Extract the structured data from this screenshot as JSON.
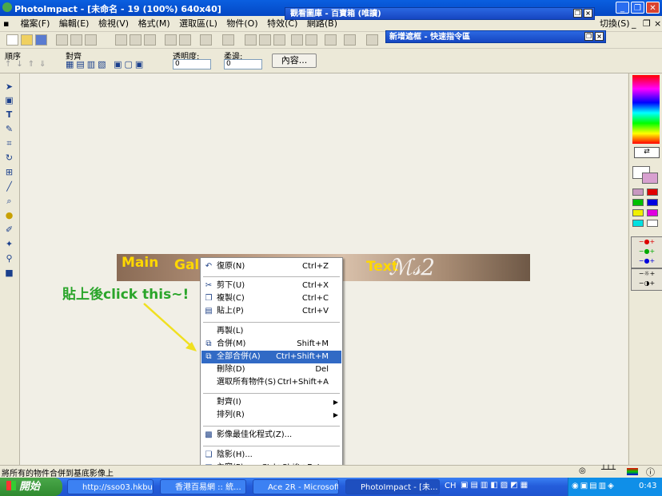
{
  "window": {
    "title": "PhotoImpact - [未命名 - 19 (100%) 640x40]"
  },
  "menu": [
    "檔案(F)",
    "編輯(E)",
    "檢視(V)",
    "格式(M)",
    "選取區(L)",
    "物件(O)",
    "特效(C)",
    "網路(B)"
  ],
  "menu_right": "切換(S)",
  "panels": {
    "panel1": "觀看圖庫 - 百寶箱 (唯讀)",
    "panel2": "新增遮框 - 快速指令區"
  },
  "attr": {
    "order_label": "順序",
    "align_label": "對齊",
    "transparency_label": "透明度:",
    "transparency_value": "0",
    "soft_edge_label": "柔邊:",
    "soft_edge_value": "0",
    "properties_button": "內容..."
  },
  "canvas": {
    "banner_main": "Main",
    "banner_gal": "Gal",
    "banner_text": "Text"
  },
  "annotation": {
    "text": "貼上後click this~!"
  },
  "context_menu": [
    {
      "label": "復原(N)",
      "shortcut": "Ctrl+Z",
      "icon": "undo-icon"
    },
    {
      "label": "剪下(U)",
      "shortcut": "Ctrl+X",
      "icon": "cut-icon"
    },
    {
      "label": "複製(C)",
      "shortcut": "Ctrl+C",
      "icon": "copy-icon"
    },
    {
      "label": "貼上(P)",
      "shortcut": "Ctrl+V",
      "icon": "paste-icon"
    },
    {
      "label": "再製(L)",
      "shortcut": "",
      "icon": ""
    },
    {
      "label": "合併(M)",
      "shortcut": "Shift+M",
      "icon": "merge-icon"
    },
    {
      "label": "全部合併(A)",
      "shortcut": "Ctrl+Shift+M",
      "icon": "merge-all-icon"
    },
    {
      "label": "刪除(D)",
      "shortcut": "Del",
      "icon": ""
    },
    {
      "label": "選取所有物件(S)",
      "shortcut": "Ctrl+Shift+A",
      "icon": ""
    },
    {
      "label": "對齊(I)",
      "shortcut": "",
      "icon": ""
    },
    {
      "label": "排列(R)",
      "shortcut": "",
      "icon": ""
    },
    {
      "label": "影像最佳化程式(Z)...",
      "shortcut": "",
      "icon": "optimizer-icon"
    },
    {
      "label": "陰影(H)...",
      "shortcut": "",
      "icon": "shadow-icon"
    },
    {
      "label": "內容(P)...",
      "shortcut": "Ctrl+Shift+Enter",
      "icon": "properties-icon"
    }
  ],
  "highlighted_item": "全部合併(A)",
  "status": {
    "text": "將所有的物件合併到基底影像上"
  },
  "taskbar": {
    "start_label": "開始",
    "tasks": [
      "http://sso03.hkbu.n...",
      "香港百易網 :: 統...",
      "Ace 2R - Microsoft ...",
      "PhotoImpact - [未..."
    ],
    "lang": "CH",
    "clock": "0:43"
  },
  "colors": {
    "title_blue": "#0a5fe0",
    "highlight": "#316ac5",
    "annotation_green": "#2aa52a",
    "banner_text": "#ffd800",
    "arrow": "#f0e020"
  }
}
